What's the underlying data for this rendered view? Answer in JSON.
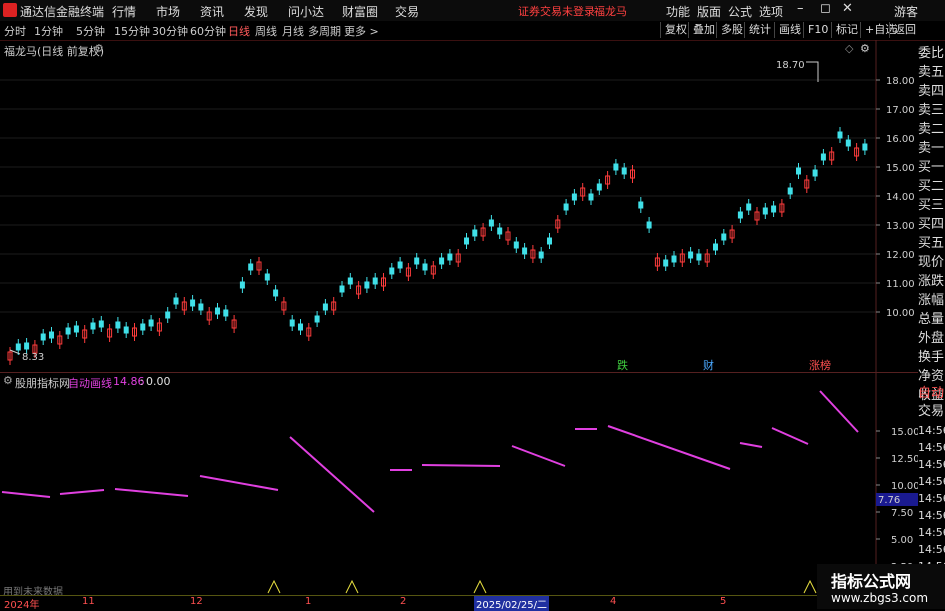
{
  "titlebar": {
    "app_name": "通达信金融终端",
    "menus": [
      "行情",
      "市场",
      "资讯",
      "发现",
      "问小达",
      "财富圈",
      "交易"
    ],
    "warning": "证券交易未登录",
    "stock": "福龙马",
    "right_menus": [
      "功能",
      "版面",
      "公式",
      "选项"
    ],
    "guest": "游客"
  },
  "toolbar": {
    "timeframes": [
      "分时",
      "1分钟",
      "5分钟",
      "15分钟",
      "30分钟",
      "60分钟",
      "日线",
      "周线",
      "月线",
      "多周期",
      "更多 >"
    ],
    "active_timeframe": "日线",
    "buttons": [
      "复权",
      "叠加",
      "多股",
      "统计",
      "画线",
      "F10",
      "标记",
      "+自选",
      "返回"
    ]
  },
  "main": {
    "title": "福龙马(日线 前复权)",
    "high_label": "18.70",
    "low_label": "8.33",
    "y_ticks": [
      "18.00",
      "17.00",
      "16.00",
      "15.00",
      "14.00",
      "13.00",
      "12.00",
      "11.00",
      "10.00"
    ],
    "markers": [
      {
        "text": "跌",
        "color": "#40d040"
      },
      {
        "text": "财",
        "color": "#4aa8ff"
      },
      {
        "text": "涨榜",
        "color": "#ff5050"
      }
    ]
  },
  "side": {
    "items": [
      "委比",
      "卖五",
      "卖四",
      "卖三",
      "卖二",
      "卖一",
      "买一",
      "买二",
      "买三",
      "买四",
      "买五",
      "现价",
      "涨跌",
      "涨幅",
      "总量",
      "外盘",
      "换手",
      "净资",
      "收益"
    ],
    "lower_items": [
      "自动",
      "交易"
    ],
    "times": [
      "14:56",
      "14:56",
      "14:56",
      "14:56",
      "14:56",
      "14:56",
      "14:56",
      "14:56",
      "14:56",
      "14:56"
    ]
  },
  "sub": {
    "title": "股朋指标网",
    "line_name": "自动画线",
    "value1": "14.86",
    "value2": "0.00",
    "y_ticks": [
      "15.00",
      "12.50",
      "10.00",
      "7.50",
      "5.00",
      "2.50"
    ],
    "highlight_value": "7.76",
    "footer_text": "用到未来数据"
  },
  "bottom": {
    "dates": [
      "2024年",
      "11",
      "12",
      "1",
      "2",
      "2025/02/25/二",
      "4",
      "5"
    ]
  },
  "watermark": {
    "line1": "指标公式网",
    "line2": "www.zbgs3.com"
  },
  "colors": {
    "up": "#ff3c3c",
    "down": "#40e0e8",
    "line": "#e040e0",
    "accent": "#ff5050"
  }
}
